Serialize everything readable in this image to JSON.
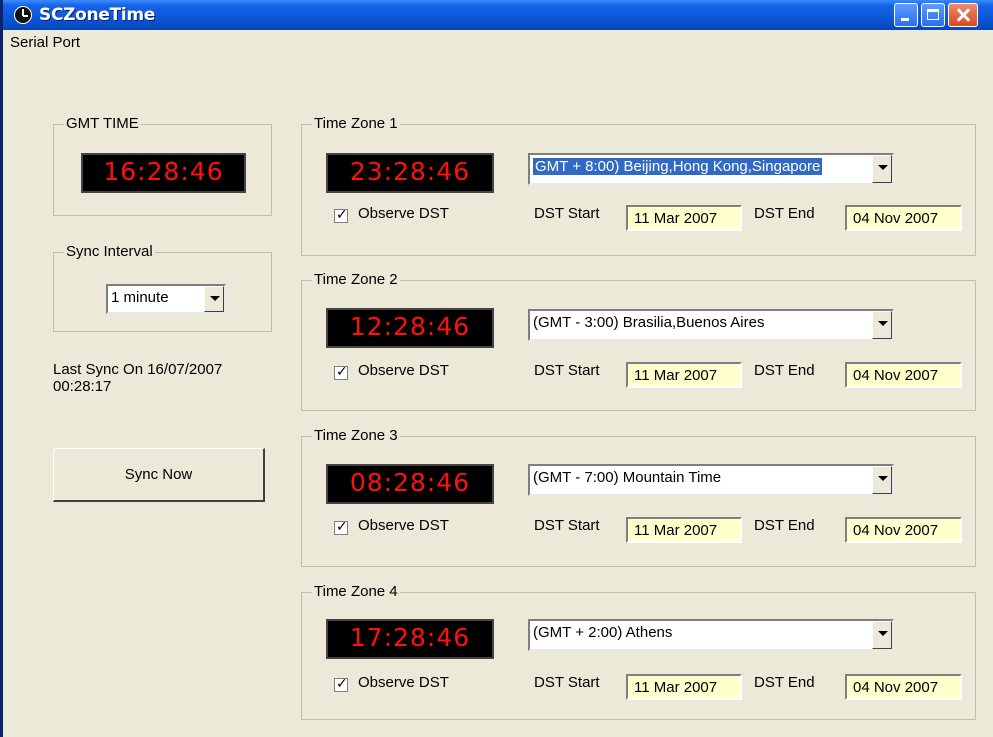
{
  "window": {
    "title": "SCZoneTime"
  },
  "menu": {
    "serial_port": "Serial Port"
  },
  "gmt": {
    "legend": "GMT TIME",
    "time": "16:28:46"
  },
  "sync": {
    "legend": "Sync Interval",
    "interval": "1 minute",
    "last_sync_line1": "Last Sync On 16/07/2007",
    "last_sync_line2": "00:28:17",
    "button_label": "Sync Now"
  },
  "zones": [
    {
      "legend": "Time Zone 1",
      "time": "23:28:46",
      "zone": "GMT + 8:00) Beijing,Hong Kong,Singapore",
      "observe_label": "Observe DST",
      "observe_checked": true,
      "dst_start_label": "DST Start",
      "dst_start": "11 Mar 2007",
      "dst_end_label": "DST End",
      "dst_end": "04 Nov 2007"
    },
    {
      "legend": "Time Zone 2",
      "time": "12:28:46",
      "zone": "(GMT - 3:00) Brasilia,Buenos Aires",
      "observe_label": "Observe DST",
      "observe_checked": true,
      "dst_start_label": "DST Start",
      "dst_start": "11 Mar 2007",
      "dst_end_label": "DST End",
      "dst_end": "04 Nov 2007"
    },
    {
      "legend": "Time Zone 3",
      "time": "08:28:46",
      "zone": "(GMT - 7:00) Mountain Time",
      "observe_label": "Observe DST",
      "observe_checked": true,
      "dst_start_label": "DST Start",
      "dst_start": "11 Mar 2007",
      "dst_end_label": "DST End",
      "dst_end": "04 Nov 2007"
    },
    {
      "legend": "Time Zone 4",
      "time": "17:28:46",
      "zone": "(GMT + 2:00) Athens",
      "observe_label": "Observe DST",
      "observe_checked": true,
      "dst_start_label": "DST Start",
      "dst_start": "11 Mar 2007",
      "dst_end_label": "DST End",
      "dst_end": "04 Nov 2007"
    }
  ],
  "icons": {
    "app": "clock-icon",
    "minimize": "minimize-icon",
    "maximize": "maximize-icon",
    "close": "close-icon",
    "dropdown": "chevron-down-icon",
    "check": "checkmark-icon"
  },
  "colors": {
    "led_digits": "#ff1010",
    "led_background": "#000000",
    "date_field": "#ffffcc",
    "titlebar": "#0a58d8",
    "selection": "#316ac5"
  }
}
